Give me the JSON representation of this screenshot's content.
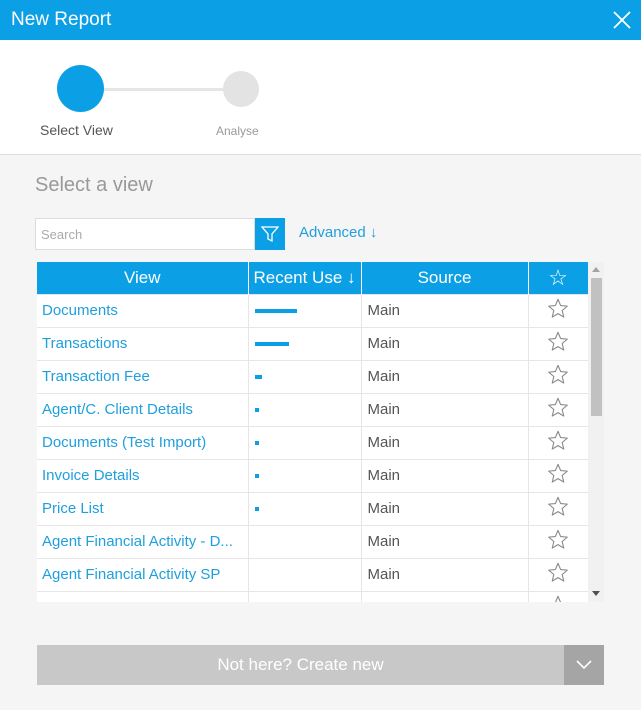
{
  "window": {
    "title": "New Report"
  },
  "stepper": {
    "steps": [
      {
        "label": "Select View",
        "active": true
      },
      {
        "label": "Analyse",
        "active": false
      }
    ]
  },
  "main": {
    "heading": "Select a view",
    "search": {
      "placeholder": "Search",
      "value": ""
    },
    "advanced_label": "Advanced ↓"
  },
  "table": {
    "columns": [
      "View",
      "Recent Use ↓",
      "Source",
      "☆"
    ],
    "rows": [
      {
        "view": "Documents",
        "recent_use": 1.0,
        "source": "Main"
      },
      {
        "view": "Transactions",
        "recent_use": 0.8,
        "source": "Main"
      },
      {
        "view": "Transaction Fee",
        "recent_use": 0.17,
        "source": "Main"
      },
      {
        "view": "Agent/C. Client Details",
        "recent_use": 0.08,
        "source": "Main"
      },
      {
        "view": "Documents (Test Import)",
        "recent_use": 0.08,
        "source": "Main"
      },
      {
        "view": "Invoice Details",
        "recent_use": 0.08,
        "source": "Main"
      },
      {
        "view": "Price List",
        "recent_use": 0.08,
        "source": "Main"
      },
      {
        "view": "Agent Financial Activity - D...",
        "recent_use": 0,
        "source": "Main"
      },
      {
        "view": "Agent Financial Activity SP",
        "recent_use": 0,
        "source": "Main"
      },
      {
        "view": "",
        "recent_use": 0,
        "source": ""
      }
    ]
  },
  "footer": {
    "create_label": "Not here? Create new"
  },
  "colors": {
    "accent": "#0ba0e6",
    "link": "#1f9fdd"
  }
}
